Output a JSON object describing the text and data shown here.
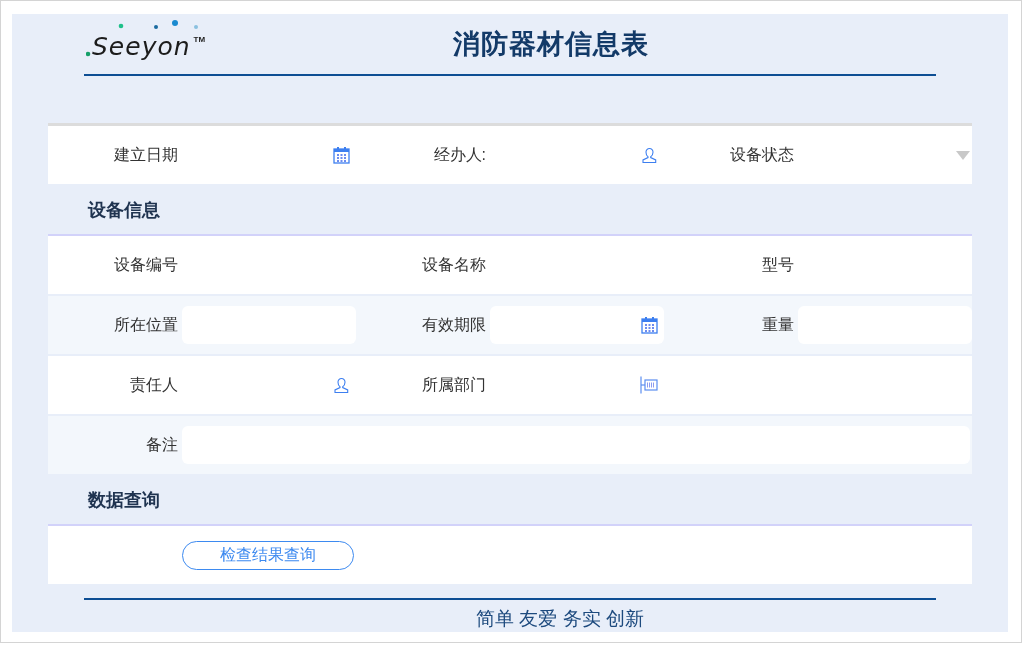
{
  "logo": {
    "text": "Seeyon",
    "mark": "TM"
  },
  "header": {
    "title": "消防器材信息表"
  },
  "top_row": [
    {
      "label": "建立日期",
      "kind": "date"
    },
    {
      "label": "经办人:",
      "kind": "person"
    },
    {
      "label": "设备状态",
      "kind": "select"
    }
  ],
  "sections": [
    {
      "title": "设备信息",
      "rows": [
        [
          {
            "label": "设备编号",
            "kind": "plain"
          },
          {
            "label": "设备名称",
            "kind": "plain"
          },
          {
            "label": "型号",
            "kind": "plain"
          }
        ],
        [
          {
            "label": "所在位置",
            "kind": "text"
          },
          {
            "label": "有效期限",
            "kind": "date"
          },
          {
            "label": "重量",
            "kind": "text"
          }
        ],
        [
          {
            "label": "责任人",
            "kind": "person"
          },
          {
            "label": "所属部门",
            "kind": "department"
          },
          {
            "kind": "none"
          }
        ],
        [
          {
            "label": "备注",
            "kind": "wide"
          }
        ]
      ]
    },
    {
      "title": "数据查询",
      "buttons": [
        "检查结果查询"
      ]
    }
  ],
  "footer": {
    "slogan": "简单 友爱 务实 创新"
  }
}
